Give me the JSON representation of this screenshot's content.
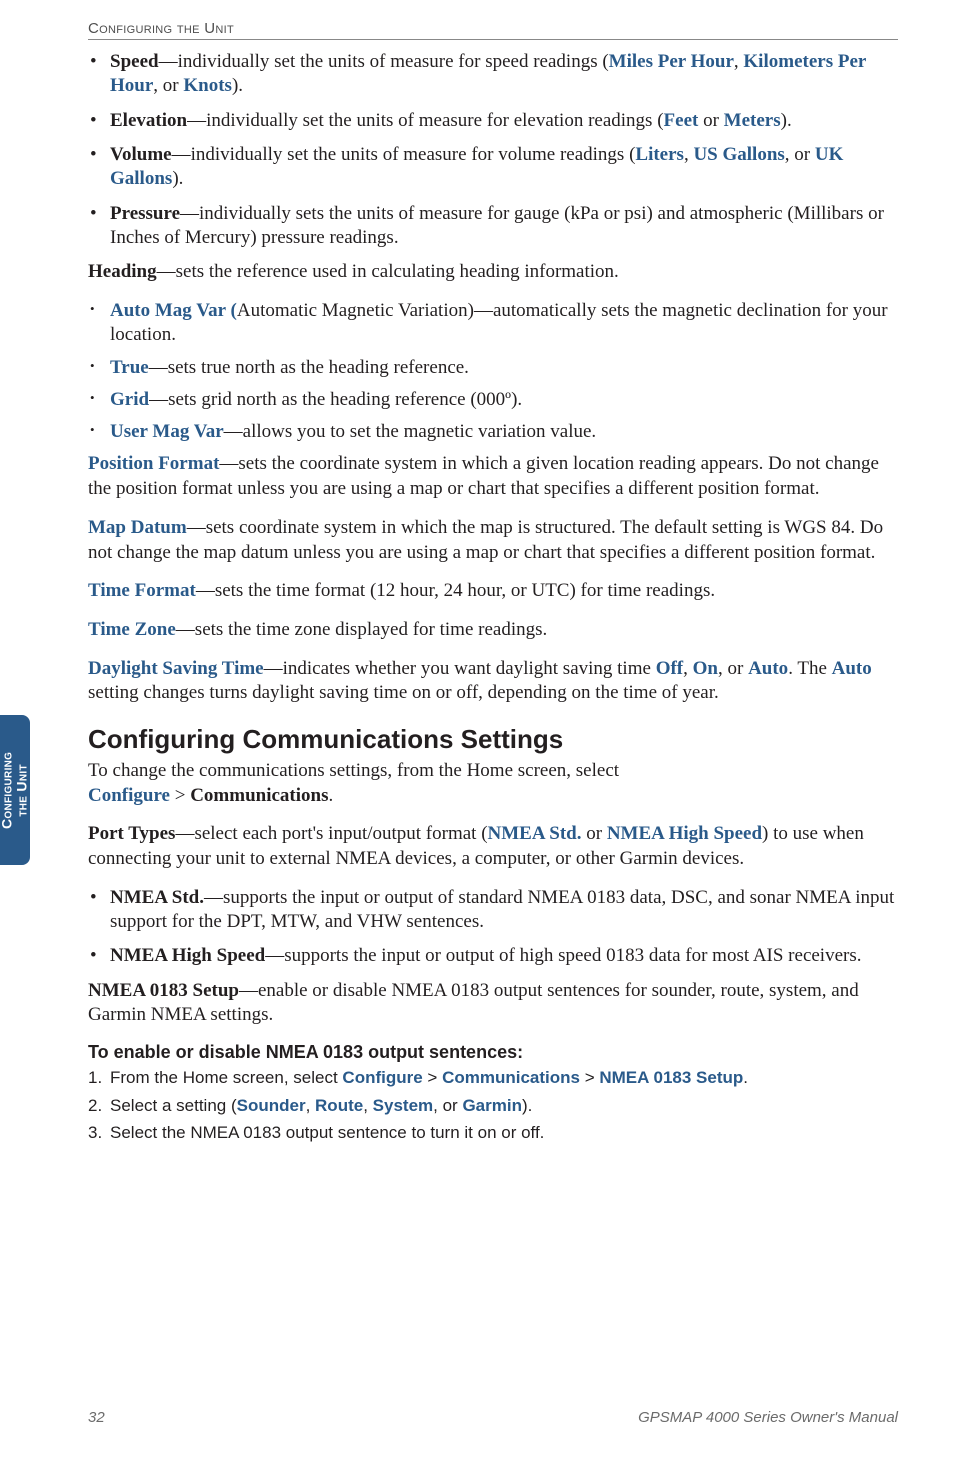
{
  "running_head": "Configuring the Unit",
  "side_tab": {
    "line1": "Configuring",
    "line2": "the Unit"
  },
  "bullets_top": [
    {
      "lead": "Speed",
      "rest1": "—individually set the units of measure for speed readings (",
      "opt1": "Miles Per Hour",
      "sep1": ", ",
      "opt2": "Kilometers Per Hour",
      "sep2": ", or ",
      "opt3": "Knots",
      "tail": ")."
    },
    {
      "lead": "Elevation",
      "rest1": "—individually set the units of measure for elevation readings (",
      "opt1": "Feet",
      "sep1": " or ",
      "opt2": "Meters",
      "tail": ")."
    },
    {
      "lead": "Volume",
      "rest1": "—individually set the units of measure for volume readings (",
      "opt1": "Liters",
      "sep1": ", ",
      "opt2": "US Gallons",
      "sep2": ", or ",
      "opt3": "UK Gallons",
      "tail": ")."
    },
    {
      "lead": "Pressure",
      "rest1": "—individually sets the units of measure for gauge (kPa or psi) and atmospheric (Millibars or Inches of Mercury) pressure readings."
    }
  ],
  "heading_para": {
    "lead": "Heading",
    "rest": "—sets the reference used in calculating heading information."
  },
  "heading_sub": [
    {
      "lead": "Auto Mag Var (",
      "rest": "Automatic Magnetic Variation)—automatically sets the magnetic declination for your location."
    },
    {
      "lead": "True",
      "rest": "—sets true north as the heading reference."
    },
    {
      "lead": "Grid",
      "rest": "—sets grid north as the heading reference (000º)."
    },
    {
      "lead": "User Mag Var",
      "rest": "—allows you to set the magnetic variation value."
    }
  ],
  "position_format": {
    "lead": "Position Format",
    "rest": "—sets the coordinate system in which a given location reading appears. Do not change the position format unless you are using a map or chart that specifies a different position format."
  },
  "map_datum": {
    "lead": "Map Datum",
    "rest": "—sets coordinate system in which the map is structured. The default setting is WGS 84. Do not change the map datum unless you are using a map or chart that specifies a different position format."
  },
  "time_format": {
    "lead": "Time Format",
    "rest": "—sets the time format (12 hour, 24 hour, or UTC) for time readings."
  },
  "time_zone": {
    "lead": "Time Zone",
    "rest": "—sets the time zone displayed for time readings."
  },
  "dst": {
    "lead": "Daylight Saving Time",
    "rest1": "—indicates whether you want daylight saving time ",
    "off": "Off",
    "sep1": ", ",
    "on": "On",
    "sep2": ", or ",
    "auto": "Auto",
    "rest2": ". The ",
    "auto2": "Auto",
    "rest3": " setting changes turns daylight saving time on or off, depending on the time of year."
  },
  "section_heading": "Configuring Communications Settings",
  "comm_intro": {
    "line1": "To change the communications settings, from the Home screen, select",
    "configure": "Configure",
    "gt": " > ",
    "communications": "Communications",
    "period": "."
  },
  "port_types": {
    "lead": "Port Types",
    "rest1": "—select each port's input/output format (",
    "nmea_std": "NMEA Std.",
    "sep1": " or ",
    "nmea_hs": "NMEA High Speed",
    "rest2": ") to use when connecting your unit to external NMEA devices, a computer, or other Garmin devices."
  },
  "port_bullets": [
    {
      "lead": "NMEA Std.",
      "rest": "—supports the input or output of standard NMEA 0183 data, DSC, and sonar NMEA input support for the DPT, MTW, and VHW sentences."
    },
    {
      "lead": "NMEA High Speed",
      "rest": "—supports the input or output of high speed 0183 data for most AIS receivers."
    }
  ],
  "nmea_setup": {
    "lead": "NMEA 0183 Setup",
    "rest": "—enable or disable NMEA 0183 output sentences for sounder, route, system, and Garmin NMEA settings."
  },
  "steps_heading": "To enable or disable NMEA 0183 output sentences:",
  "steps": [
    {
      "num": "1.",
      "pre": "From the Home screen, select ",
      "c1": "Configure",
      "g1": " > ",
      "c2": "Communications",
      "g2": " > ",
      "c3": "NMEA 0183 Setup",
      "post": "."
    },
    {
      "num": "2.",
      "pre": "Select a setting (",
      "c1": "Sounder",
      "g1": ", ",
      "c2": "Route",
      "g2": ", ",
      "c3": "System",
      "g3": ", or ",
      "c4": "Garmin",
      "post": ")."
    },
    {
      "num": "3.",
      "pre": "Select the NMEA 0183 output sentence to turn it on or off."
    }
  ],
  "footer": {
    "page": "32",
    "manual": "GPSMAP 4000 Series Owner's Manual"
  }
}
